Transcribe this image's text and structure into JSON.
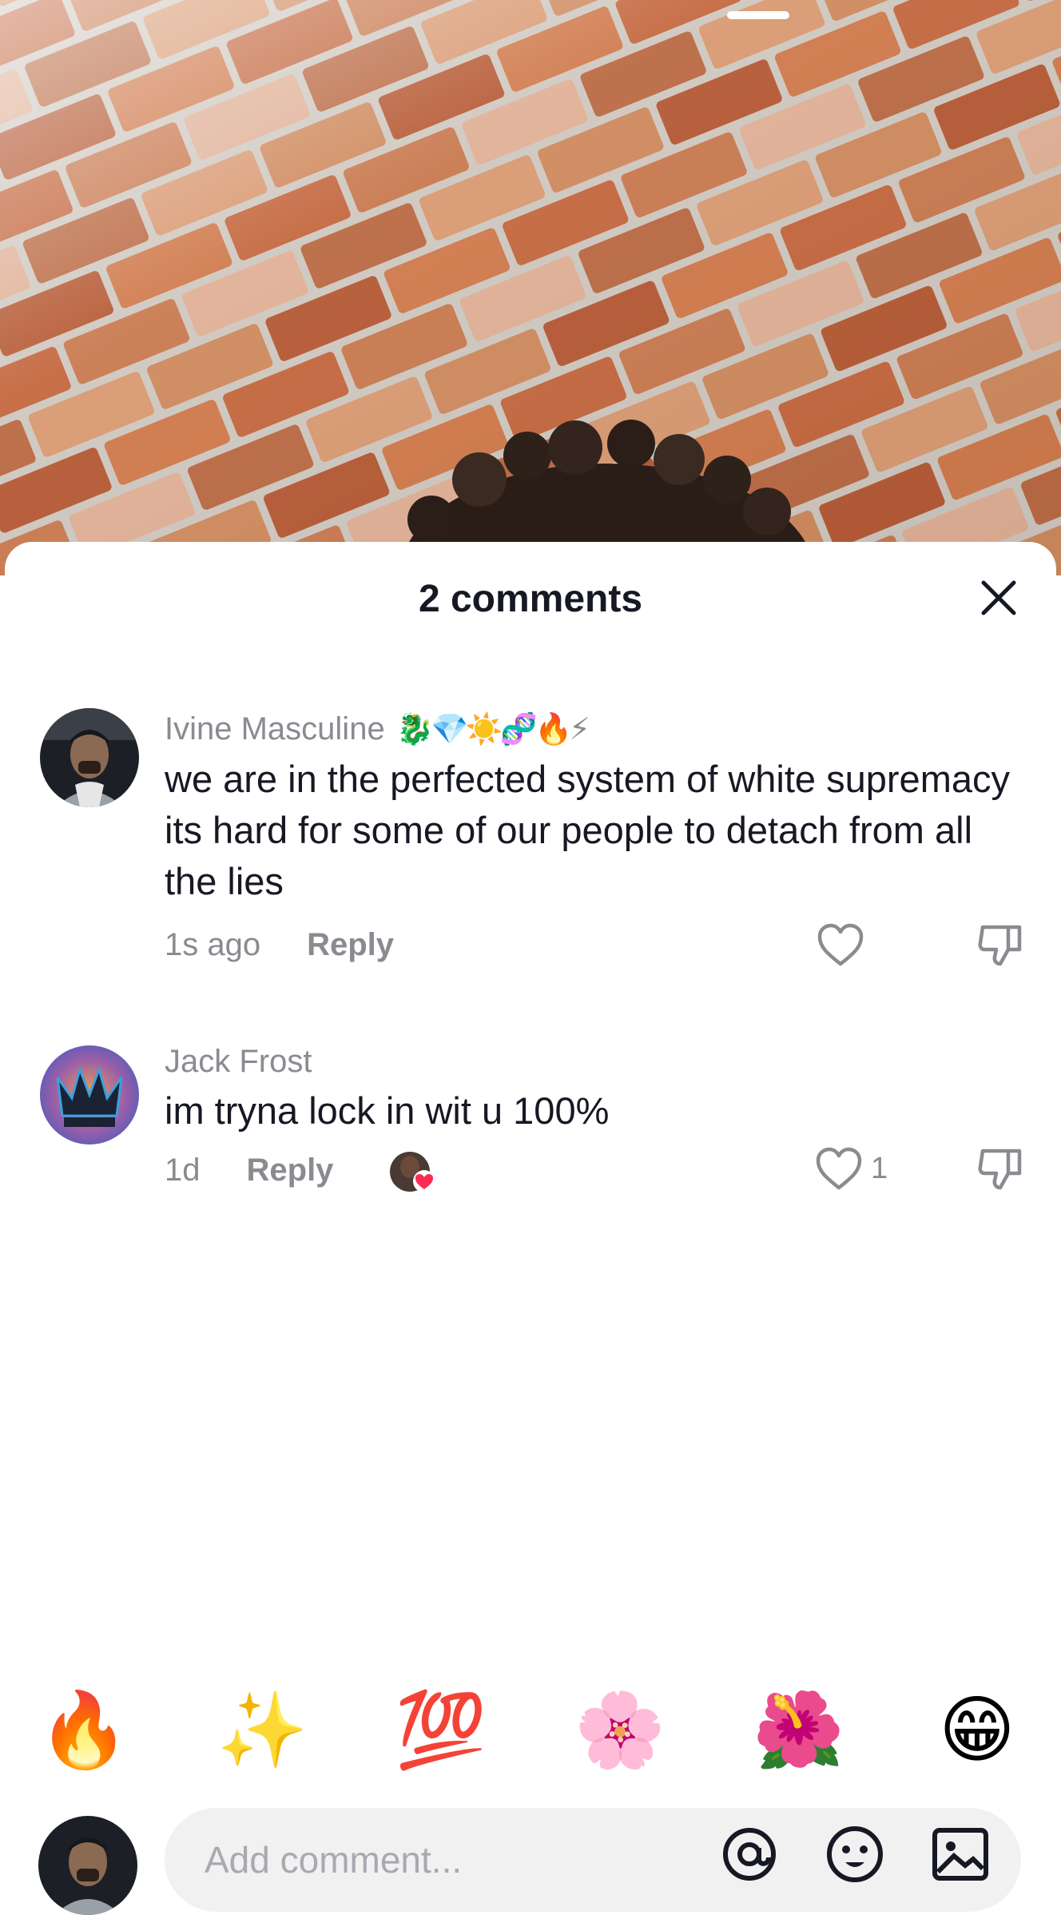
{
  "sheet": {
    "title": "2 comments",
    "close_icon": "close-icon"
  },
  "comments": [
    {
      "username": "Ivine Masculine",
      "badges": "🐉💎☀️🧬🔥⚡",
      "text": "we are in the perfected system of white supremacy its hard for some of our people to detach from all the lies",
      "time": "1s ago",
      "reply_label": "Reply",
      "likes": "",
      "icons": [
        "heart-outline-icon",
        "thumbs-down-icon"
      ]
    },
    {
      "username": "Jack Frost",
      "badges": "",
      "text": "im tryna lock in wit u 100%",
      "time": "1d",
      "reply_label": "Reply",
      "likes": "1",
      "liked_by_creator": true,
      "icons": [
        "heart-outline-icon",
        "thumbs-down-icon"
      ]
    }
  ],
  "emoji_bar": [
    "🔥",
    "✨",
    "💯",
    "🌸",
    "🌺",
    "😁"
  ],
  "input": {
    "placeholder": "Add comment...",
    "icons": [
      "at-icon",
      "emoji-face-icon",
      "image-icon"
    ]
  },
  "colors": {
    "text_primary": "#161823",
    "text_secondary": "#8a8b91",
    "input_bg": "#f1f1f2",
    "heart_red": "#fe2c55"
  }
}
